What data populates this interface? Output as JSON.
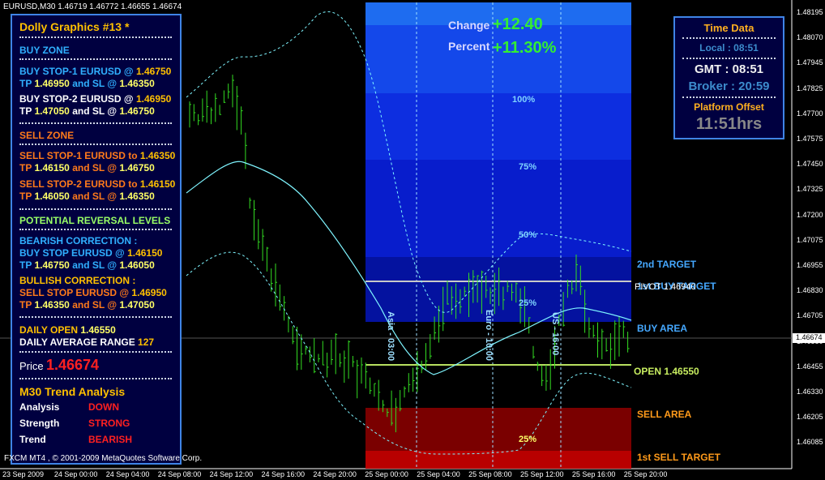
{
  "header": {
    "title": "EURUSD,M30  1.46719 1.46772 1.46655 1.46674"
  },
  "panel": {
    "title": "Dolly Graphics #13 *",
    "buy_zone": "BUY ZONE",
    "buy_stop1_a": "BUY STOP-1  EURUSD  @",
    "buy_stop1_v": "1.46750",
    "buy_stop1_tp": "TP",
    "buy_stop1_tp_v": "1.46950",
    "buy_stop1_sl": "and SL @",
    "buy_stop1_sl_v": "1.46350",
    "buy_stop2_a": "BUY STOP-2  EURUSD  @",
    "buy_stop2_v": "1.46950",
    "buy_stop2_tp": "TP",
    "buy_stop2_tp_v": "1.47050",
    "buy_stop2_sl": "and SL @",
    "buy_stop2_sl_v": "1.46750",
    "sell_zone": "SELL ZONE",
    "sell_stop1_a": "SELL STOP-1  EURUSD to",
    "sell_stop1_v": "1.46350",
    "sell_stop1_tp": "TP",
    "sell_stop1_tp_v": "1.46150",
    "sell_stop1_sl": "and SL @",
    "sell_stop1_sl_v": "1.46750",
    "sell_stop2_a": "SELL STOP-2  EURUSD to",
    "sell_stop2_v": "1.46150",
    "sell_stop2_tp": "TP",
    "sell_stop2_tp_v": "1.46050",
    "sell_stop2_sl": "and SL @",
    "sell_stop2_sl_v": "1.46350",
    "reversal": "POTENTIAL REVERSAL LEVELS",
    "bear_corr": "BEARISH CORRECTION :",
    "bear_a": "BUY STOP EURUSD  @",
    "bear_v": "1.46150",
    "bear_tp": "TP",
    "bear_tp_v": "1.46750",
    "bear_sl": "and SL @",
    "bear_sl_v": "1.46050",
    "bull_corr": "BULLISH CORRECTION :",
    "bull_a": "SELL STOP EURUSD  @",
    "bull_v": "1.46950",
    "bull_tp": "TP",
    "bull_tp_v": "1.46350",
    "bull_sl": "and SL @",
    "bull_sl_v": "1.47050",
    "daily_open_l": "DAILY OPEN",
    "daily_open_v": "1.46550",
    "dar_l": "DAILY AVERAGE RANGE",
    "dar_v": "127",
    "price_l": "Price",
    "price_v": "1.46674",
    "trend_title": "M30 Trend Analysis",
    "analysis_l": "Analysis",
    "analysis_v": "DOWN",
    "strength_l": "Strength",
    "strength_v": "STRONG",
    "trend_l": "Trend",
    "trend_v": "BEARISH",
    "copyright": "FXCM MT4 , © 2001-2009 MetaQuotes Software Corp."
  },
  "time_box": {
    "title": "Time Data",
    "local": "Local : 08:51",
    "gmt": "GMT : 08:51",
    "broker": "Broker : 20:59",
    "offset_l": "Platform Offset",
    "offset_v": "11:51hrs"
  },
  "change": {
    "change_l": "Change",
    "change_v": "+12.40",
    "percent_l": "Percent",
    "percent_v": "+11.30%"
  },
  "zone_labels": {
    "p100": "100%",
    "p75": "75%",
    "p50": "50%",
    "p25": "25%",
    "p25b": "25%"
  },
  "session_labels": {
    "asia": "Asia - 03:00",
    "euro": "Euro - 10:00",
    "us": "US - 16:00"
  },
  "right_labels": {
    "second_target": "2nd TARGET",
    "first_buy_target": "1st BUY TARGET",
    "pivot": "PIVOT 1.46940",
    "buy_area": "BUY AREA",
    "open": "OPEN 1.46550",
    "sell_area": "SELL AREA",
    "first_sell_target": "1st SELL TARGET"
  },
  "price_axis": [
    "1.48195",
    "1.48070",
    "1.47945",
    "1.47825",
    "1.47700",
    "1.47575",
    "1.47450",
    "1.47325",
    "1.47200",
    "1.47075",
    "1.46955",
    "1.46830",
    "1.46705",
    "1.46580",
    "1.46455",
    "1.46330",
    "1.46205",
    "1.46085"
  ],
  "current_price_tag": "1.46674",
  "time_axis": [
    "23 Sep 2009",
    "24 Sep 00:00",
    "24 Sep 04:00",
    "24 Sep 08:00",
    "24 Sep 12:00",
    "24 Sep 16:00",
    "24 Sep 20:00",
    "25 Sep 00:00",
    "25 Sep 04:00",
    "25 Sep 08:00",
    "25 Sep 12:00",
    "25 Sep 16:00",
    "25 Sep 20:00"
  ],
  "colors": {
    "background": "#000000",
    "bars": "#33dd22",
    "ma": "#7ff5ff",
    "panel_bg": "#000040",
    "panel_border": "#3f84e6",
    "buy_zone": "#0a1fc8",
    "sell_zone": "#880000"
  }
}
